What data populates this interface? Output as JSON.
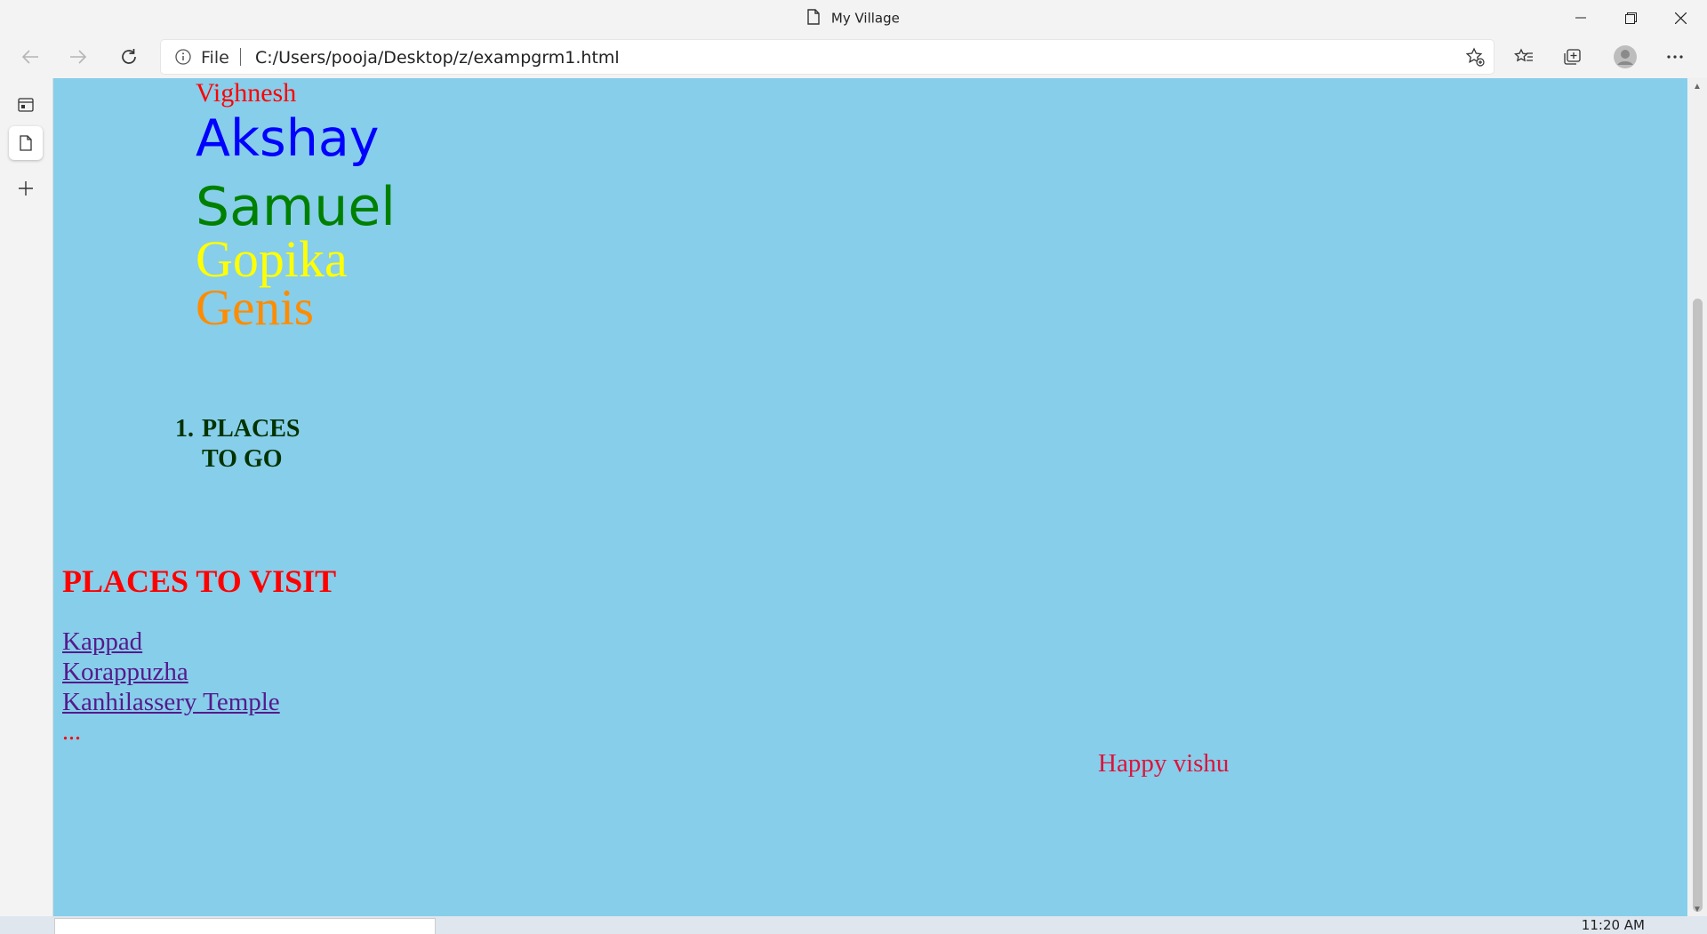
{
  "window": {
    "title": "My Village"
  },
  "address_bar": {
    "scheme_label": "File",
    "url": "C:/Users/pooja/Desktop/z/exampgrm1.html"
  },
  "page": {
    "names": [
      "Vighnesh",
      "Akshay",
      "Samuel",
      "Gopika",
      "Genis"
    ],
    "ordered_list": {
      "number": "1.",
      "line1": "PLACES",
      "line2": "TO GO"
    },
    "visit_heading": "PLACES TO VISIT",
    "places": [
      "Kappad",
      "Korappuzha",
      "Kanhilassery Temple"
    ],
    "ellipsis": "...",
    "greeting": "Happy vishu",
    "background_color": "#87ceeb"
  },
  "taskbar": {
    "clock": "11:20 AM"
  }
}
